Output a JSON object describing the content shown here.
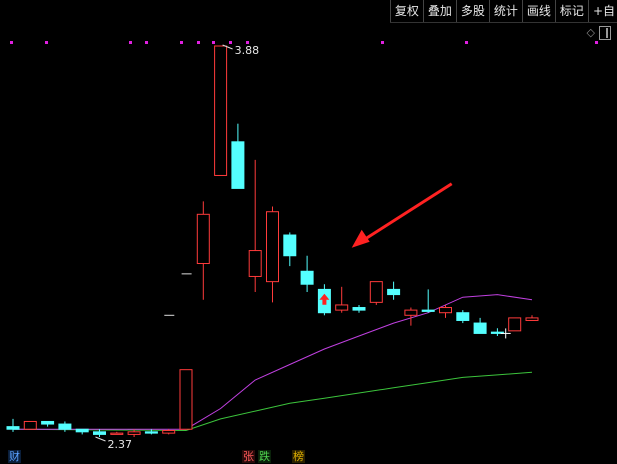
{
  "toolbar": {
    "buttons": [
      "复权",
      "叠加",
      "多股",
      "统计",
      "画线",
      "标记",
      "+自"
    ]
  },
  "icons": {
    "settings": "diamond-icon",
    "layout": "window-icon"
  },
  "tags": {
    "cai": "财",
    "zhang": "张",
    "die": "跌",
    "bang": "榜"
  },
  "colors": {
    "up": "#ff3b3b",
    "down": "#54ffff",
    "ma_short": "#c040e0",
    "ma_long": "#3cc43c",
    "marker_dots": "#e020e0",
    "arrow": "#ff2222"
  },
  "chart_data": {
    "type": "candlestick",
    "price_range": [
      2.3,
      3.95
    ],
    "high_label": "3.88",
    "low_label": "2.37",
    "candles": [
      {
        "o": 2.41,
        "h": 2.44,
        "l": 2.39,
        "c": 2.4
      },
      {
        "o": 2.4,
        "h": 2.43,
        "l": 2.4,
        "c": 2.43
      },
      {
        "o": 2.43,
        "h": 2.43,
        "l": 2.41,
        "c": 2.42
      },
      {
        "o": 2.42,
        "h": 2.43,
        "l": 2.39,
        "c": 2.4
      },
      {
        "o": 2.4,
        "h": 2.4,
        "l": 2.38,
        "c": 2.39
      },
      {
        "o": 2.39,
        "h": 2.4,
        "l": 2.37,
        "c": 2.38
      },
      {
        "o": 2.38,
        "h": 2.39,
        "l": 2.38,
        "c": 2.385
      },
      {
        "o": 2.38,
        "h": 2.4,
        "l": 2.37,
        "c": 2.39
      },
      {
        "o": 2.39,
        "h": 2.4,
        "l": 2.38,
        "c": 2.385
      },
      {
        "o": 2.385,
        "h": 2.4,
        "l": 2.38,
        "c": 2.395
      },
      {
        "o": 2.4,
        "h": 2.63,
        "l": 2.4,
        "c": 2.63
      },
      {
        "o": 3.04,
        "h": 3.28,
        "l": 2.9,
        "c": 3.23
      },
      {
        "o": 3.38,
        "h": 3.88,
        "l": 3.38,
        "c": 3.88
      },
      {
        "o": 3.51,
        "h": 3.58,
        "l": 3.33,
        "c": 3.33
      },
      {
        "o": 2.99,
        "h": 3.44,
        "l": 2.93,
        "c": 3.09
      },
      {
        "o": 2.97,
        "h": 3.26,
        "l": 2.89,
        "c": 3.24
      },
      {
        "o": 3.15,
        "h": 3.16,
        "l": 3.03,
        "c": 3.07
      },
      {
        "o": 3.01,
        "h": 3.07,
        "l": 2.93,
        "c": 2.96
      },
      {
        "o": 2.94,
        "h": 2.96,
        "l": 2.84,
        "c": 2.85
      },
      {
        "o": 2.86,
        "h": 2.95,
        "l": 2.85,
        "c": 2.88
      },
      {
        "o": 2.87,
        "h": 2.88,
        "l": 2.85,
        "c": 2.86
      },
      {
        "o": 2.89,
        "h": 2.97,
        "l": 2.88,
        "c": 2.97
      },
      {
        "o": 2.94,
        "h": 2.97,
        "l": 2.9,
        "c": 2.92
      },
      {
        "o": 2.84,
        "h": 2.87,
        "l": 2.8,
        "c": 2.86
      },
      {
        "o": 2.86,
        "h": 2.94,
        "l": 2.85,
        "c": 2.855
      },
      {
        "o": 2.85,
        "h": 2.88,
        "l": 2.83,
        "c": 2.87
      },
      {
        "o": 2.85,
        "h": 2.86,
        "l": 2.81,
        "c": 2.82
      },
      {
        "o": 2.81,
        "h": 2.83,
        "l": 2.77,
        "c": 2.77
      },
      {
        "o": 2.775,
        "h": 2.79,
        "l": 2.76,
        "c": 2.77
      },
      {
        "o": 2.78,
        "h": 2.83,
        "l": 2.78,
        "c": 2.83
      },
      {
        "o": 2.82,
        "h": 2.84,
        "l": 2.82,
        "c": 2.83
      }
    ],
    "ma_short": [
      [
        0,
        2.4
      ],
      [
        10,
        2.4
      ],
      [
        12,
        2.48
      ],
      [
        14,
        2.59
      ],
      [
        16,
        2.65
      ],
      [
        18,
        2.71
      ],
      [
        20,
        2.76
      ],
      [
        22,
        2.81
      ],
      [
        24,
        2.85
      ],
      [
        26,
        2.91
      ],
      [
        28,
        2.92
      ],
      [
        30,
        2.9
      ]
    ],
    "ma_long": [
      [
        0,
        2.4
      ],
      [
        10,
        2.395
      ],
      [
        12,
        2.44
      ],
      [
        14,
        2.47
      ],
      [
        16,
        2.5
      ],
      [
        18,
        2.52
      ],
      [
        20,
        2.54
      ],
      [
        22,
        2.56
      ],
      [
        24,
        2.58
      ],
      [
        26,
        2.6
      ],
      [
        28,
        2.61
      ],
      [
        30,
        2.62
      ]
    ],
    "signal_arrow_index": 19,
    "up_arrow_index": 18,
    "short_marks": [
      {
        "index": 12,
        "value": 3.0
      },
      {
        "index": 11,
        "value": 2.84
      }
    ]
  }
}
